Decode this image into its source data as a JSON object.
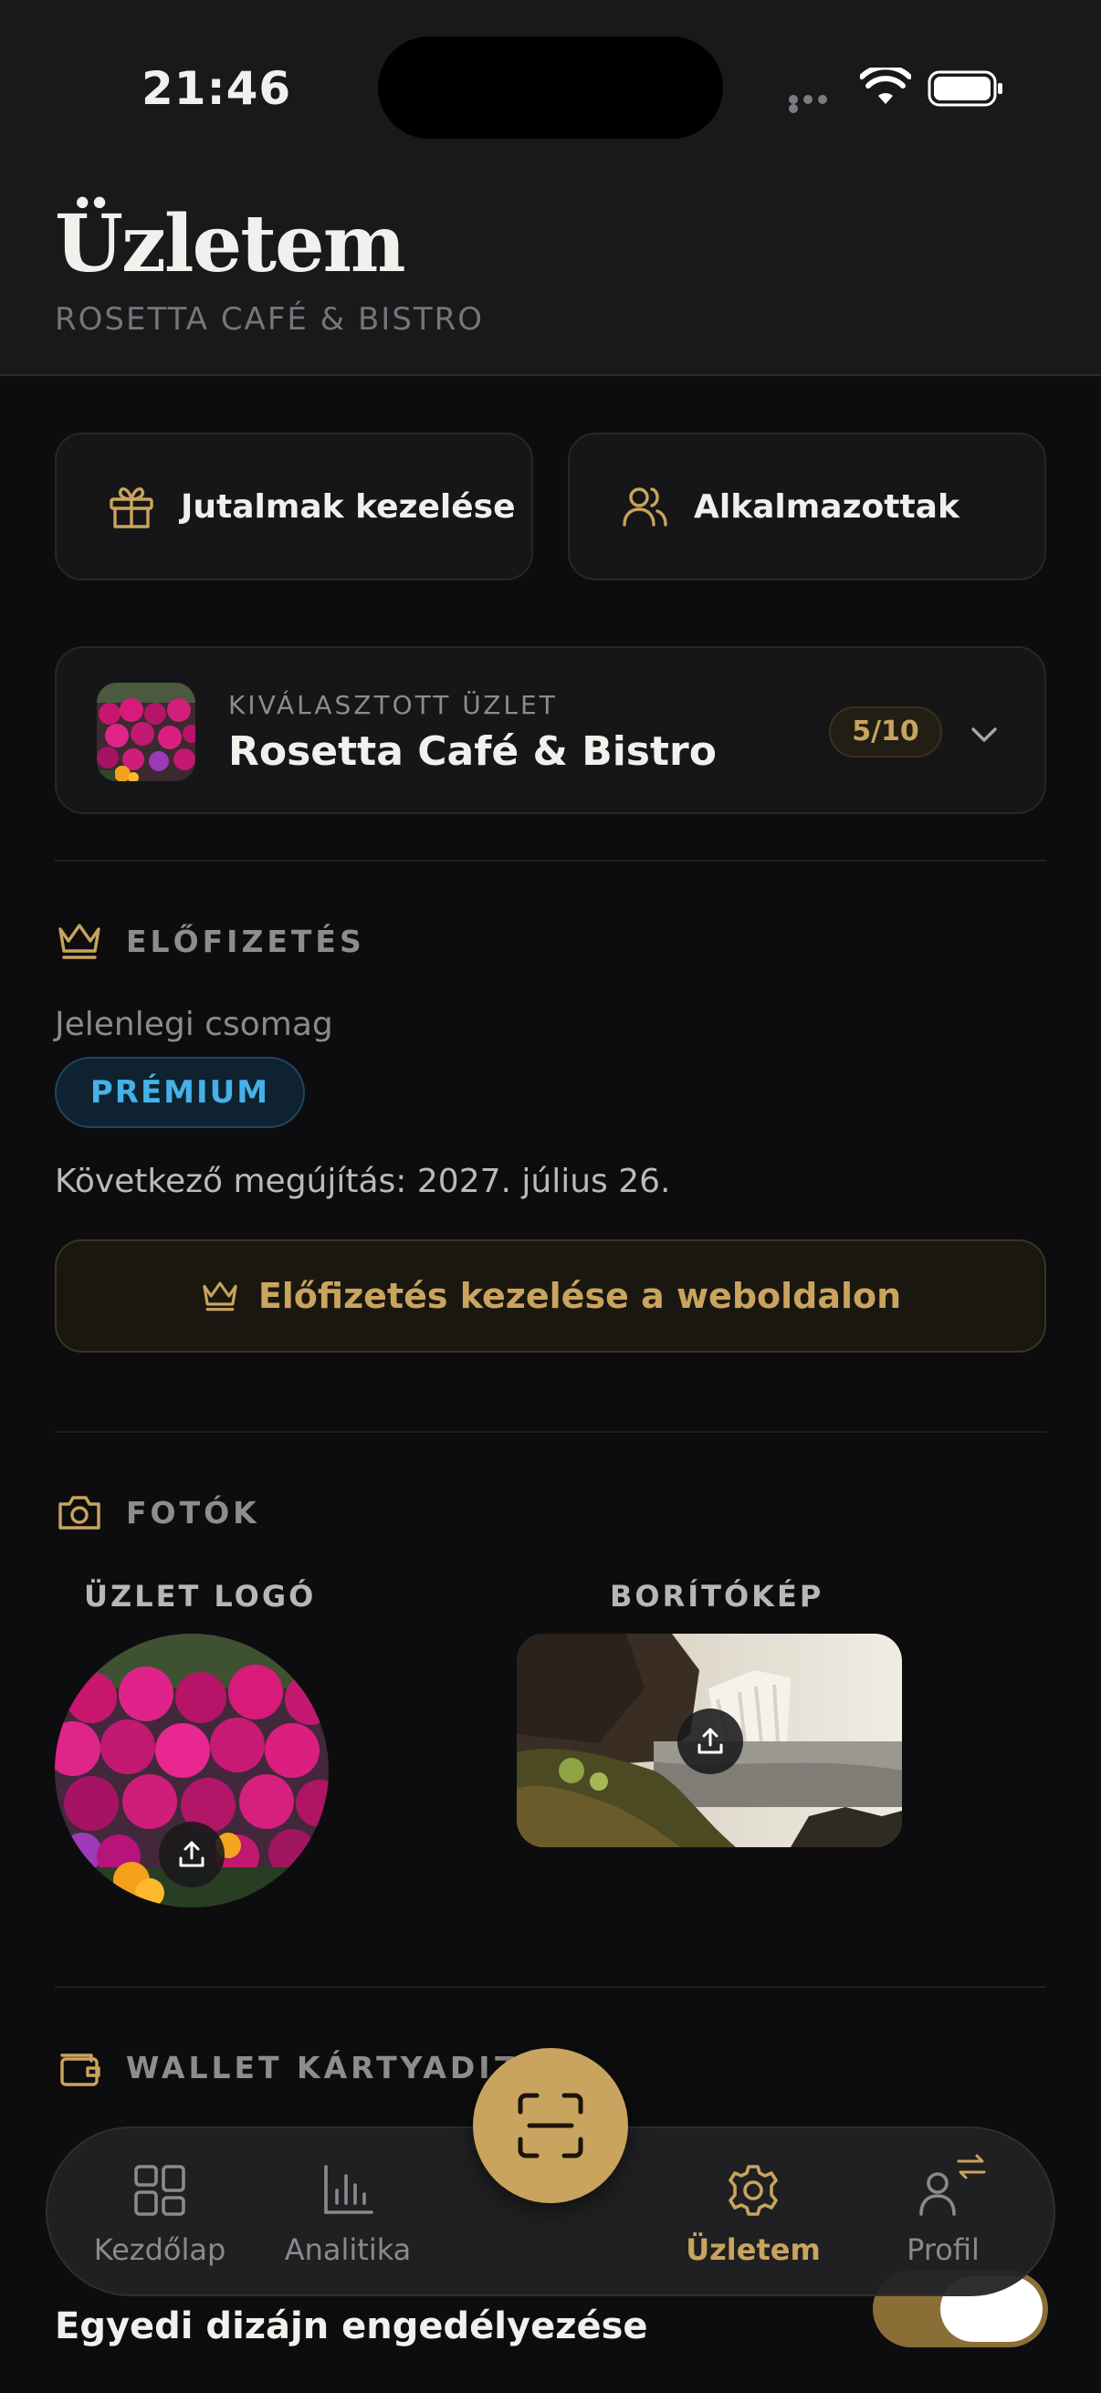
{
  "status_bar": {
    "time": "21:46"
  },
  "header": {
    "title": "Üzletem",
    "subtitle": "ROSETTA CAFÉ & BISTRO"
  },
  "quick_actions": [
    {
      "label": "Jutalmak kezelése",
      "icon": "gift-icon"
    },
    {
      "label": "Alkalmazottak",
      "icon": "users-icon"
    }
  ],
  "store_selector": {
    "caption": "KIVÁLASZTOTT ÜZLET",
    "name": "Rosetta Café & Bistro",
    "count_badge": "5/10"
  },
  "subscription": {
    "section_label": "ELŐFIZETÉS",
    "current_plan_label": "Jelenlegi csomag",
    "plan": "PRÉMIUM",
    "renewal": "Következő megújítás: 2027. július 26.",
    "manage_button": "Előfizetés kezelése a weboldalon"
  },
  "photos": {
    "section_label": "FOTÓK",
    "logo_label": "ÜZLET LOGÓ",
    "cover_label": "BORÍTÓKÉP"
  },
  "wallet": {
    "section_label": "WALLET KÁRTYADIZÁ",
    "custom_design_label": "Egyedi dizájn engedélyezése",
    "custom_design_enabled": true
  },
  "tab_bar": {
    "tabs": [
      {
        "label": "Kezdőlap",
        "icon": "home-grid-icon",
        "active": false
      },
      {
        "label": "Analitika",
        "icon": "bar-chart-icon",
        "active": false
      },
      {
        "label": "Üzletem",
        "icon": "gear-icon",
        "active": true
      },
      {
        "label": "Profil",
        "icon": "profile-switch-icon",
        "active": false
      }
    ],
    "center_action": "scan-icon"
  },
  "colors": {
    "accent_gold": "#c9a45e",
    "premium_blue": "#45b1e8",
    "background": "#0d0d0f",
    "card": "#161618"
  }
}
